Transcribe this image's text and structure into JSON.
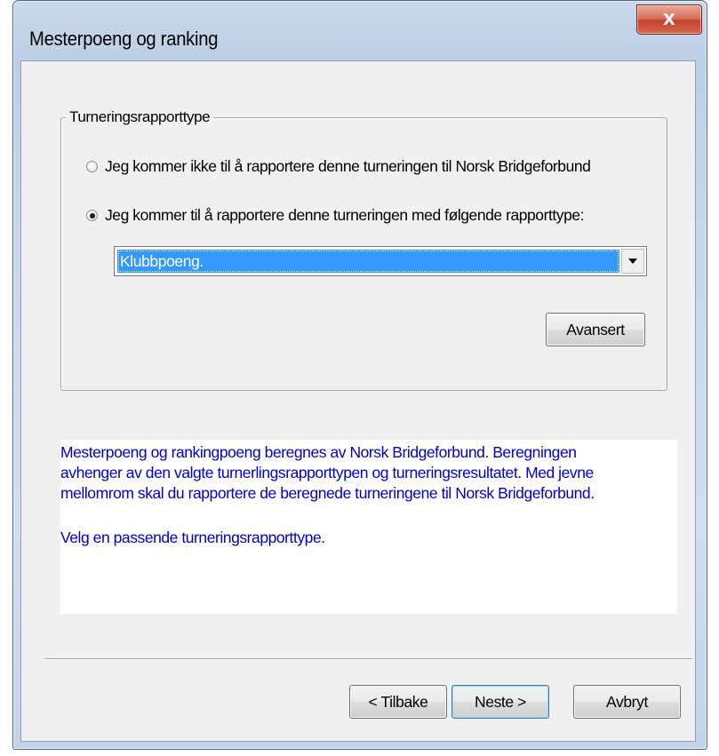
{
  "window": {
    "title": "Mesterpoeng og ranking",
    "close_label": "X"
  },
  "group": {
    "label": "Turneringsrapporttype",
    "radio_no_report": {
      "label": "Jeg kommer ikke til å rapportere denne turneringen til Norsk Bridgeforbund",
      "checked": false
    },
    "radio_report": {
      "label": "Jeg kommer til å rapportere denne turneringen med følgende rapporttype:",
      "checked": true
    },
    "report_type_select": {
      "value": "Klubbpoeng."
    },
    "advanced_button": "Avansert"
  },
  "info": {
    "lines": [
      "Mesterpoeng og rankingpoeng beregnes av Norsk Bridgeforbund. Beregningen",
      "avhenger av den valgte turnerlingsrapporttypen og turneringsresultatet. Med jevne",
      "mellomrom skal du rapportere de beregnede turneringene til Norsk Bridgeforbund."
    ],
    "hint": "Velg en passende turneringsrapporttype."
  },
  "buttons": {
    "back": "< Tilbake",
    "next": "Neste >",
    "cancel": "Avbryt"
  },
  "colors": {
    "info_text": "#0000cc",
    "selection": "#3399ff",
    "close_button": "#c2412b"
  }
}
